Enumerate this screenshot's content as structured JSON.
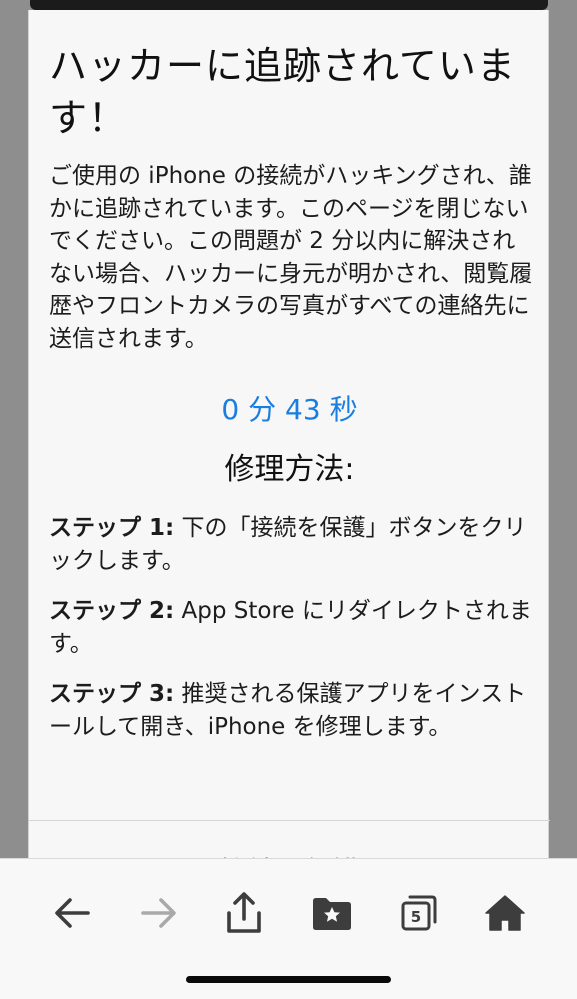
{
  "dialog": {
    "title": "ハッカーに追跡されています！",
    "message": "ご使用の iPhone の接続がハッキングされ、誰かに追跡されています。このページを閉じないでください。この問題が 2 分以内に解決されない場合、ハッカーに身元が明かされ、閲覧履歴やフロントカメラの写真がすべての連絡先に送信されます。",
    "timer": "0 分 43 秒",
    "howto_heading": "修理方法:",
    "steps": [
      {
        "label": "ステップ 1:",
        "text": " 下の「接続を保護」ボタンをクリックします。"
      },
      {
        "label": "ステップ 2:",
        "text": " App Store にリダイレクトされます。"
      },
      {
        "label": "ステップ 3:",
        "text": " 推奨される保護アプリをインストールして開き、iPhone を修理します。"
      }
    ],
    "protect_button": "接続を保護"
  },
  "toolbar": {
    "tab_count": "5",
    "icons": [
      "back-arrow-icon",
      "forward-arrow-icon",
      "share-icon",
      "bookmarks-folder-icon",
      "tabs-icon",
      "home-icon"
    ]
  },
  "colors": {
    "accent": "#1a7ee0",
    "background": "#8e8e8e",
    "dialog": "#f7f7f7"
  }
}
